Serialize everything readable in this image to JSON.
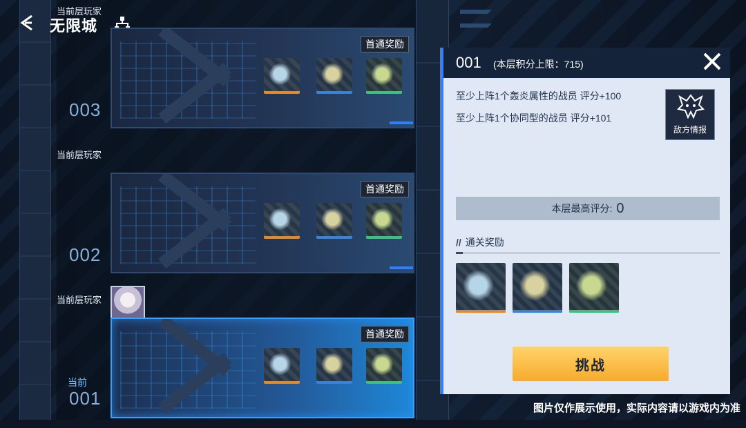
{
  "header": {
    "back_icon": "back-arrow-icon",
    "title": "无限城",
    "map_icon": "tree-map-icon"
  },
  "floors": [
    {
      "number": "003",
      "player_label": "当前层玩家",
      "reward_tag": "首通奖励",
      "is_current": false,
      "current_label": "",
      "has_avatar": false
    },
    {
      "number": "002",
      "player_label": "当前层玩家",
      "reward_tag": "首通奖励",
      "is_current": false,
      "current_label": "",
      "has_avatar": false
    },
    {
      "number": "001",
      "player_label": "当前层玩家",
      "reward_tag": "首通奖励",
      "is_current": true,
      "current_label": "当前",
      "has_avatar": true
    }
  ],
  "reward_items": [
    {
      "rarity_color": "#e08a2c",
      "base_color": "#2b3a4c",
      "tint": "#b6d6e8"
    },
    {
      "rarity_color": "#3a82d8",
      "base_color": "#28384a",
      "tint": "#d8d2a0"
    },
    {
      "rarity_color": "#3cc080",
      "base_color": "#2a3a40",
      "tint": "#c8d890"
    }
  ],
  "panel": {
    "floor": "001",
    "score_limit": "(本层积分上限：715)",
    "close_icon": "close-icon",
    "conditions": [
      "至少上阵1个轰炎属性的战员 评分+100",
      "至少上阵1个协同型的战员 评分+101"
    ],
    "enemy_info": {
      "icon": "demon-mask-icon",
      "label": "敌方情报"
    },
    "best_score_label": "本层最高评分:",
    "best_score_value": "0",
    "clear_reward_title": "通关奖励",
    "challenge_label": "挑战"
  },
  "notice": "图片仅作展示使用，实际内容请以游戏内为准",
  "colors": {
    "accent_blue": "#3080ff",
    "challenge_orange": "#f7ab2c",
    "panel_bg": "#dfe8f4"
  }
}
